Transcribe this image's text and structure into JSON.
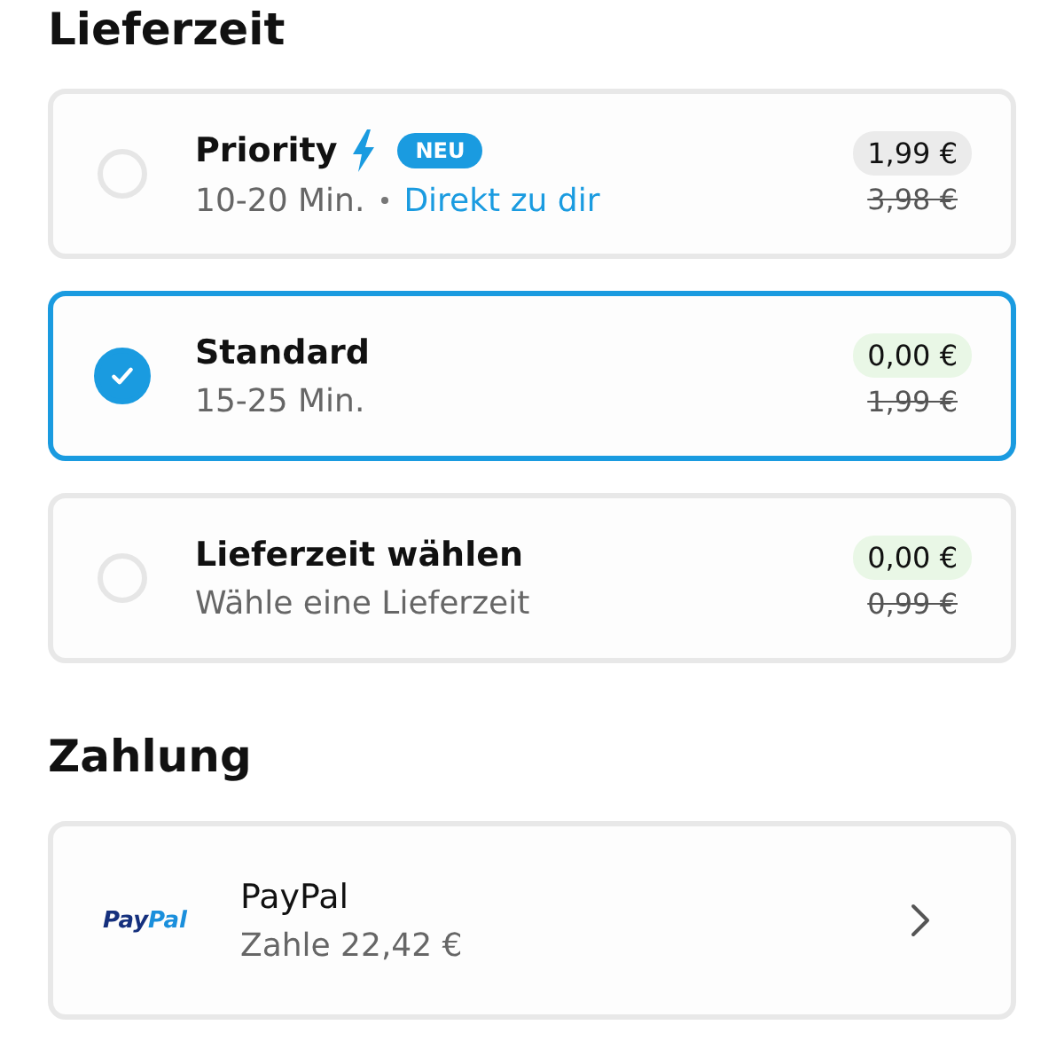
{
  "delivery": {
    "heading": "Lieferzeit",
    "options": [
      {
        "kind": "express",
        "title": "Priority",
        "badge": "NEU",
        "time": "10-20 Min.",
        "link": "Direkt zu dir",
        "price": "1,99 €",
        "color": "#ebebeb",
        "old_price": "3,98 €",
        "selected": false
      },
      {
        "kind": "standard",
        "title": "Standard",
        "time": "15-25 Min.",
        "price": "0,00 €",
        "color": "#e9f7e6",
        "old_price": "1,99 €",
        "selected": true
      },
      {
        "kind": "scheduled",
        "title": "Lieferzeit wählen",
        "time": "Wähle eine Lieferzeit",
        "price": "0,00 €",
        "color": "#e9f7e6",
        "old_price": "0,99 €",
        "selected": false
      }
    ]
  },
  "payment": {
    "heading": "Zahlung",
    "method": {
      "logo": [
        "Pay",
        "Pal"
      ],
      "title": "PayPal",
      "subtitle": "Zahle 22,42 €"
    }
  }
}
